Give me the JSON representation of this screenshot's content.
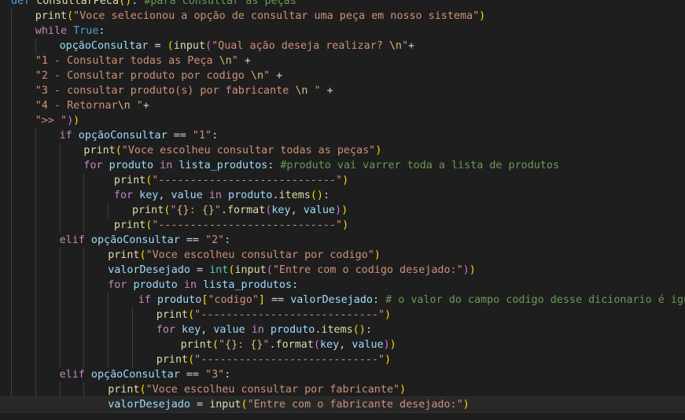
{
  "editor": {
    "language": "python",
    "theme": "dark",
    "lines": [
      {
        "indent": 0,
        "tokens": [
          [
            "kw",
            "def "
          ],
          [
            "fn",
            "consultarPeca"
          ],
          [
            "b1",
            "()"
          ],
          [
            "op",
            ": "
          ],
          [
            "cmt",
            "#para consultar as peças"
          ]
        ]
      },
      {
        "indent": 4,
        "tokens": [
          [
            "fn",
            "print"
          ],
          [
            "b1",
            "("
          ],
          [
            "str",
            "\"Voce selecionou a opção de consultar uma peça em nosso sistema\""
          ],
          [
            "b1",
            ")"
          ]
        ]
      },
      {
        "indent": 4,
        "tokens": [
          [
            "ctrl",
            "while "
          ],
          [
            "kw",
            "True"
          ],
          [
            "op",
            ":"
          ]
        ]
      },
      {
        "indent": 8,
        "tokens": [
          [
            "var",
            "opçãoConsultar"
          ],
          [
            "op",
            " = "
          ],
          [
            "b1",
            "("
          ],
          [
            "fn",
            "input"
          ],
          [
            "b2",
            "("
          ],
          [
            "str",
            "\"Qual ação deseja realizar? "
          ],
          [
            "esc",
            "\\n"
          ],
          [
            "str",
            "\""
          ],
          [
            "op",
            "+"
          ]
        ]
      },
      {
        "indent": 4,
        "tokens": [
          [
            "str",
            "\"1 - Consultar todas as Peça "
          ],
          [
            "esc",
            "\\n"
          ],
          [
            "str",
            "\""
          ],
          [
            "op",
            " +"
          ]
        ]
      },
      {
        "indent": 4,
        "tokens": [
          [
            "str",
            "\"2 - Consultar produto por codigo "
          ],
          [
            "esc",
            "\\n"
          ],
          [
            "str",
            "\""
          ],
          [
            "op",
            " +"
          ]
        ]
      },
      {
        "indent": 4,
        "tokens": [
          [
            "str",
            "\"3 - consultar produto(s) por fabricante "
          ],
          [
            "esc",
            "\\n"
          ],
          [
            "str",
            " \""
          ],
          [
            "op",
            " +"
          ]
        ]
      },
      {
        "indent": 4,
        "tokens": [
          [
            "str",
            "\"4 - Retornar"
          ],
          [
            "esc",
            "\\n"
          ],
          [
            "str",
            " \""
          ],
          [
            "op",
            "+"
          ]
        ]
      },
      {
        "indent": 4,
        "tokens": [
          [
            "str",
            "\">> \""
          ],
          [
            "b2",
            ")"
          ],
          [
            "b1",
            ")"
          ]
        ]
      },
      {
        "indent": 8,
        "tokens": [
          [
            "ctrl",
            "if "
          ],
          [
            "var",
            "opçãoConsultar"
          ],
          [
            "op",
            " == "
          ],
          [
            "str",
            "\"1\""
          ],
          [
            "op",
            ":"
          ]
        ]
      },
      {
        "indent": 12,
        "tokens": [
          [
            "fn",
            "print"
          ],
          [
            "b1",
            "("
          ],
          [
            "str",
            "\"Voce escolheu consultar todas as peças\""
          ],
          [
            "b1",
            ")"
          ]
        ]
      },
      {
        "indent": 12,
        "tokens": [
          [
            "ctrl",
            "for "
          ],
          [
            "var",
            "produto"
          ],
          [
            "ctrl",
            " in "
          ],
          [
            "var",
            "lista_produtos"
          ],
          [
            "op",
            ": "
          ],
          [
            "cmt",
            "#produto vai varrer toda a lista de produtos"
          ]
        ]
      },
      {
        "indent": 17,
        "tokens": [
          [
            "fn",
            "print"
          ],
          [
            "b1",
            "("
          ],
          [
            "str",
            "\"----------------------------\""
          ],
          [
            "b1",
            ")"
          ]
        ]
      },
      {
        "indent": 17,
        "tokens": [
          [
            "ctrl",
            "for "
          ],
          [
            "var",
            "key"
          ],
          [
            "op",
            ", "
          ],
          [
            "var",
            "value"
          ],
          [
            "ctrl",
            " in "
          ],
          [
            "var",
            "produto"
          ],
          [
            "op",
            "."
          ],
          [
            "fn",
            "items"
          ],
          [
            "b1",
            "()"
          ],
          [
            "op",
            ":"
          ]
        ]
      },
      {
        "indent": 20,
        "tokens": [
          [
            "fn",
            "print"
          ],
          [
            "b1",
            "("
          ],
          [
            "str",
            "\""
          ],
          [
            "esc",
            "{}"
          ],
          [
            "str",
            ": "
          ],
          [
            "esc",
            "{}"
          ],
          [
            "str",
            "\""
          ],
          [
            "op",
            "."
          ],
          [
            "fn",
            "format"
          ],
          [
            "b2",
            "("
          ],
          [
            "var",
            "key"
          ],
          [
            "op",
            ", "
          ],
          [
            "var",
            "value"
          ],
          [
            "b2",
            ")"
          ],
          [
            "b1",
            ")"
          ]
        ]
      },
      {
        "indent": 17,
        "tokens": [
          [
            "fn",
            "print"
          ],
          [
            "b1",
            "("
          ],
          [
            "str",
            "\"----------------------------\""
          ],
          [
            "b1",
            ")"
          ]
        ]
      },
      {
        "indent": 8,
        "tokens": [
          [
            "ctrl",
            "elif "
          ],
          [
            "var",
            "opçãoConsultar"
          ],
          [
            "op",
            " == "
          ],
          [
            "str",
            "\"2\""
          ],
          [
            "op",
            ":"
          ]
        ]
      },
      {
        "indent": 16,
        "tokens": [
          [
            "fn",
            "print"
          ],
          [
            "b1",
            "("
          ],
          [
            "str",
            "\"Voce escolheu consultar por codigo\""
          ],
          [
            "b1",
            ")"
          ]
        ]
      },
      {
        "indent": 16,
        "tokens": [
          [
            "var",
            "valorDesejado"
          ],
          [
            "op",
            " = "
          ],
          [
            "type",
            "int"
          ],
          [
            "b1",
            "("
          ],
          [
            "fn",
            "input"
          ],
          [
            "b2",
            "("
          ],
          [
            "str",
            "\"Entre com o codigo desejado:\""
          ],
          [
            "b2",
            ")"
          ],
          [
            "b1",
            ")"
          ]
        ]
      },
      {
        "indent": 16,
        "tokens": [
          [
            "ctrl",
            "for "
          ],
          [
            "var",
            "produto"
          ],
          [
            "ctrl",
            " in "
          ],
          [
            "var",
            "lista_produtos"
          ],
          [
            "op",
            ":"
          ]
        ]
      },
      {
        "indent": 21,
        "tokens": [
          [
            "ctrl",
            "if "
          ],
          [
            "var",
            "produto"
          ],
          [
            "b1",
            "["
          ],
          [
            "str",
            "\"codigo\""
          ],
          [
            "b1",
            "]"
          ],
          [
            "op",
            " == "
          ],
          [
            "var",
            "valorDesejado"
          ],
          [
            "op",
            ": "
          ],
          [
            "cmt",
            "# o valor do campo codigo desse dicionario é igual o"
          ]
        ]
      },
      {
        "indent": 24,
        "tokens": [
          [
            "fn",
            "print"
          ],
          [
            "b1",
            "("
          ],
          [
            "str",
            "\"----------------------------\""
          ],
          [
            "b1",
            ")"
          ]
        ]
      },
      {
        "indent": 24,
        "tokens": [
          [
            "ctrl",
            "for "
          ],
          [
            "var",
            "key"
          ],
          [
            "op",
            ", "
          ],
          [
            "var",
            "value"
          ],
          [
            "ctrl",
            " in "
          ],
          [
            "var",
            "produto"
          ],
          [
            "op",
            "."
          ],
          [
            "fn",
            "items"
          ],
          [
            "b1",
            "()"
          ],
          [
            "op",
            ":"
          ]
        ]
      },
      {
        "indent": 28,
        "tokens": [
          [
            "fn",
            "print"
          ],
          [
            "b1",
            "("
          ],
          [
            "str",
            "\""
          ],
          [
            "esc",
            "{}"
          ],
          [
            "str",
            ": "
          ],
          [
            "esc",
            "{}"
          ],
          [
            "str",
            "\""
          ],
          [
            "op",
            "."
          ],
          [
            "fn",
            "format"
          ],
          [
            "b2",
            "("
          ],
          [
            "var",
            "key"
          ],
          [
            "op",
            ", "
          ],
          [
            "var",
            "value"
          ],
          [
            "b2",
            ")"
          ],
          [
            "b1",
            ")"
          ]
        ]
      },
      {
        "indent": 24,
        "tokens": [
          [
            "fn",
            "print"
          ],
          [
            "b1",
            "("
          ],
          [
            "str",
            "\"----------------------------\""
          ],
          [
            "b1",
            ")"
          ]
        ]
      },
      {
        "indent": 8,
        "tokens": [
          [
            "ctrl",
            "elif "
          ],
          [
            "var",
            "opçãoConsultar"
          ],
          [
            "op",
            " == "
          ],
          [
            "str",
            "\"3\""
          ],
          [
            "op",
            ":"
          ]
        ]
      },
      {
        "indent": 16,
        "tokens": [
          [
            "fn",
            "print"
          ],
          [
            "b1",
            "("
          ],
          [
            "str",
            "\"Voce escolheu consultar por fabricante\""
          ],
          [
            "b1",
            ")"
          ]
        ]
      },
      {
        "indent": 16,
        "active": true,
        "tokens": [
          [
            "var",
            "valorDesejado"
          ],
          [
            "op",
            " = "
          ],
          [
            "fn",
            "input"
          ],
          [
            "b1",
            "("
          ],
          [
            "str",
            "\"Entre com o fabricante desejado:\""
          ],
          [
            "b1",
            ")"
          ]
        ]
      }
    ]
  }
}
